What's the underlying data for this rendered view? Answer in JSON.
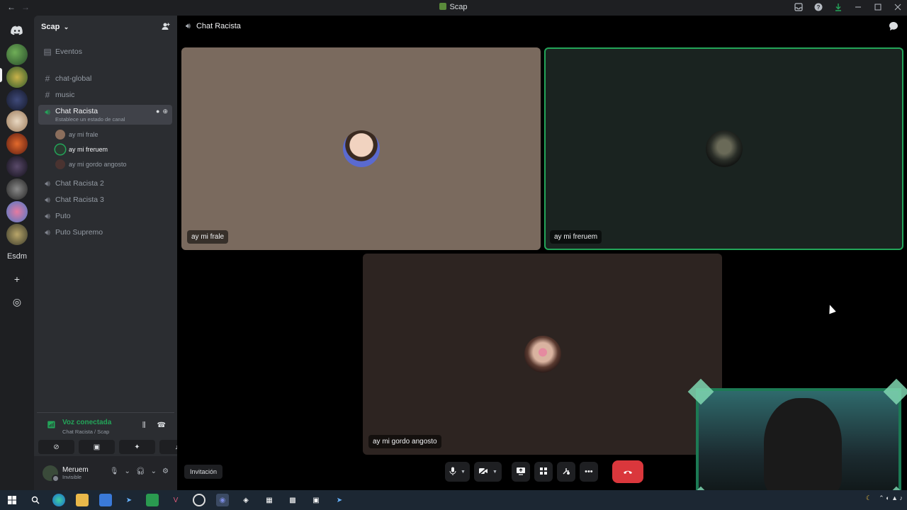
{
  "window": {
    "title": "Scap",
    "nav_back": "←",
    "nav_forward": "→"
  },
  "rail": {
    "text_server": "Esdm",
    "add_server": "+",
    "discover": "◎"
  },
  "sidebar": {
    "server_name": "Scap",
    "events_label": "Eventos",
    "channels": [
      {
        "label": "chat-global",
        "type": "text"
      },
      {
        "label": "music",
        "type": "text"
      },
      {
        "label": "Chat Racista",
        "type": "voice",
        "status": "Establece un estado de canal"
      },
      {
        "label": "Chat Racista 2",
        "type": "voice"
      },
      {
        "label": "Chat Racista 3",
        "type": "voice"
      },
      {
        "label": "Puto",
        "type": "voice"
      },
      {
        "label": "Puto Supremo",
        "type": "voice"
      }
    ],
    "voice_users": [
      {
        "name": "ay mi frale",
        "speaking": false
      },
      {
        "name": "ay mi freruem",
        "speaking": true
      },
      {
        "name": "ay mi gordo angosto",
        "speaking": false
      }
    ],
    "voice_panel": {
      "status": "Voz conectada",
      "location": "Chat Racista / Scap"
    },
    "user": {
      "name": "Meruem",
      "status": "Invisible"
    }
  },
  "stage": {
    "channel_name": "Chat Racista",
    "invite_label": "Invitación",
    "tiles": [
      {
        "name": "ay mi frale",
        "bg": "#7a6a5e"
      },
      {
        "name": "ay mi freruem",
        "bg": "#1a2320"
      },
      {
        "name": "ay mi gordo angosto",
        "bg": "#2d2421"
      }
    ]
  },
  "colors": {
    "accent_green": "#23a559",
    "hangup_red": "#da373c",
    "sidebar_bg": "#2b2d31",
    "rail_bg": "#1e1f22"
  },
  "icons": {
    "discord": "discord-icon",
    "speaker": "speaker-icon",
    "hash": "hash-icon",
    "mic": "mic-icon",
    "camera_off": "camera-off-icon",
    "screen_share": "screen-share-icon",
    "activities": "activities-icon",
    "soundboard": "soundboard-icon",
    "more": "more-icon",
    "hangup": "hangup-icon"
  }
}
